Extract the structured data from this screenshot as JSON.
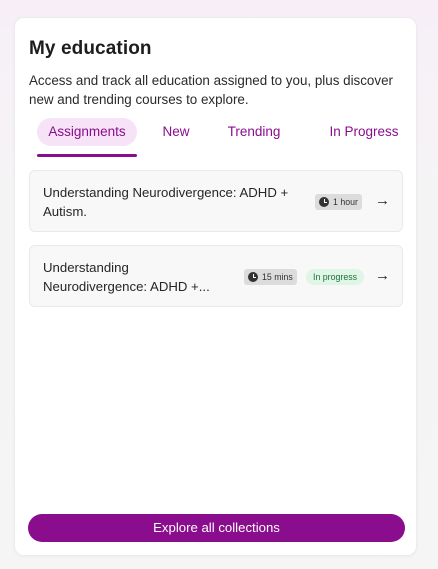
{
  "widget": {
    "title": "My education",
    "description": "Access and track all education assigned to you, plus discover new and trending courses to explore."
  },
  "tabs": [
    {
      "label": "Assignments",
      "active": true
    },
    {
      "label": "New",
      "active": false
    },
    {
      "label": "Trending",
      "active": false
    },
    {
      "label": "In Progress",
      "active": false
    }
  ],
  "assignments": [
    {
      "title_line1": "Understanding Neurodivergence: ADHD +",
      "title_line2": "Autism.",
      "duration": "1 hour",
      "status": ""
    },
    {
      "title_line1": "Understanding",
      "title_line2": "Neurodivergence: ADHD +...",
      "duration": "15 mins",
      "status": "In progress"
    }
  ],
  "icons": {
    "duration": "clock-icon",
    "open": "arrow-right-icon"
  },
  "cta": {
    "label": "Explore all collections"
  },
  "colors": {
    "accent": "#8a0d8d",
    "tab_active_bg": "#f6e3f7",
    "status_bg": "#dff5e6",
    "status_text": "#1f6e3c"
  }
}
